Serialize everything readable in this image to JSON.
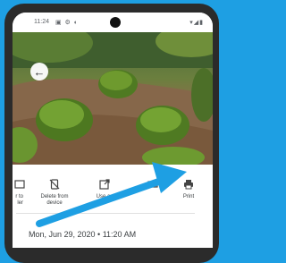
{
  "status_bar": {
    "time": "11:24",
    "indicators": "▣ ⚙ ◐",
    "system": "▾◢▮"
  },
  "actions": [
    {
      "label": "r to\nler",
      "icon": "archive-icon"
    },
    {
      "label": "Delete from\ndevice",
      "icon": "delete-from-device-icon"
    },
    {
      "label": "Use as",
      "icon": "open-external-icon"
    },
    {
      "label": "",
      "icon": "screen-icon"
    },
    {
      "label": "Print",
      "icon": "printer-icon"
    }
  ],
  "photo_info": {
    "date": "Mon, Jun 29, 2020 • 11:20 AM"
  },
  "colors": {
    "background": "#1e9fe3",
    "arrow": "#1e9fe3"
  }
}
